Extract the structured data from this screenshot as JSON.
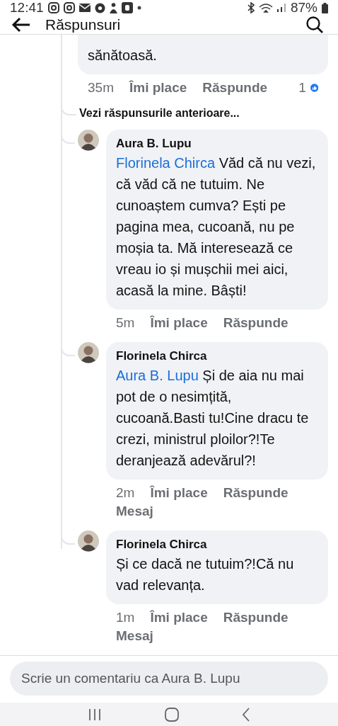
{
  "status_bar": {
    "time": "12:41",
    "battery": "87%"
  },
  "header": {
    "title": "Răspunsuri"
  },
  "previous_comment": {
    "text": "sănătoasă.",
    "time": "35m",
    "actions": [
      "Îmi place",
      "Răspunde"
    ],
    "reaction_count": "1"
  },
  "more_replies": "Vezi răspunsurile anterioare...",
  "comments": [
    {
      "author": "Aura B. Lupu",
      "mention": "Florinela Chirca",
      "text": "Văd că nu vezi, că văd că ne tutuim. Ne cunoaștem cumva? Ești pe pagina mea, cucoană, nu pe moșia ta. Mă interesează ce vreau io și mușchii mei aici, acasă la mine. Bâști!",
      "time": "5m",
      "actions": [
        "Îmi place",
        "Răspunde"
      ]
    },
    {
      "author": "Florinela Chirca",
      "mention": "Aura B. Lupu",
      "text": "Și de aia nu mai pot de o nesimțită, cucoană.Basti tu!Cine dracu te crezi, ministrul ploilor?!Te deranjează adevărul?!",
      "time": "2m",
      "actions": [
        "Îmi place",
        "Răspunde",
        "Mesaj"
      ]
    },
    {
      "author": "Florinela Chirca",
      "text": "Și ce dacă ne tutuim?!Că nu vad relevanța.",
      "time": "1m",
      "actions": [
        "Îmi place",
        "Răspunde",
        "Mesaj"
      ]
    }
  ],
  "composer": {
    "placeholder": "Scrie un comentariu ca Aura B. Lupu"
  }
}
